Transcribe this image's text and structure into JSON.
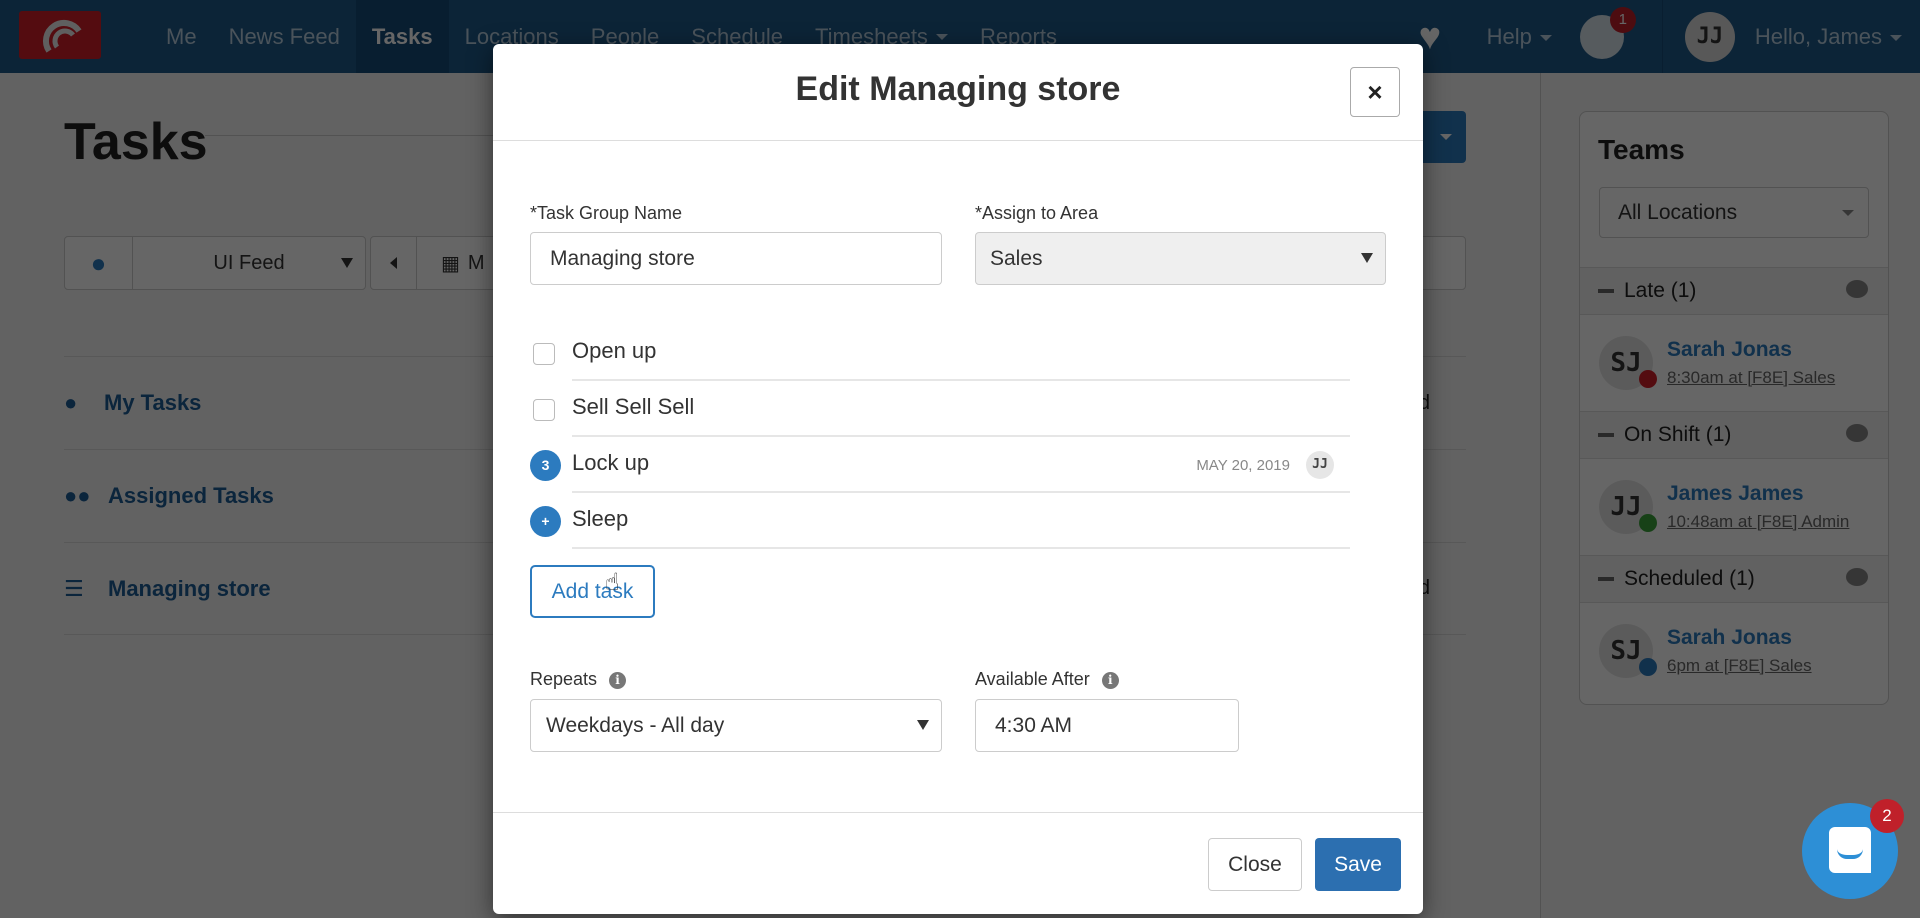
{
  "nav": {
    "items": [
      {
        "label": "Me"
      },
      {
        "label": "News Feed"
      },
      {
        "label": "Tasks",
        "active": true
      },
      {
        "label": "Locations"
      },
      {
        "label": "People"
      },
      {
        "label": "Schedule"
      },
      {
        "label": "Timesheets",
        "dropdown": true
      },
      {
        "label": "Reports"
      }
    ],
    "help_label": "Help",
    "notifications_count": "1",
    "user_initials": "JJ",
    "greeting": "Hello, James",
    "icons": {
      "logo": "app-logo",
      "heart": "heart-icon",
      "globe": "globe-icon"
    }
  },
  "page": {
    "title": "Tasks",
    "toolbar": {
      "feed_select": "UI Feed",
      "date_prefix": "M"
    },
    "task_groups": [
      {
        "label": "My Tasks",
        "icon": "user-icon",
        "tail": "d"
      },
      {
        "label": "Assigned Tasks",
        "icon": "users-icon",
        "tail": ""
      },
      {
        "label": "Managing store",
        "icon": "list-icon",
        "tail": "d"
      }
    ]
  },
  "teams": {
    "title": "Teams",
    "location_select": "All Locations",
    "groups": [
      {
        "label": "Late (1)",
        "people": [
          {
            "initials": "SJ",
            "name": "Sarah Jonas",
            "shift": "8:30am at [F8E] Sales",
            "status_color": "#d3202a"
          }
        ]
      },
      {
        "label": "On Shift (1)",
        "people": [
          {
            "initials": "JJ",
            "name": "James James",
            "shift": "10:48am at [F8E] Admin",
            "status_color": "#3aa33a"
          }
        ]
      },
      {
        "label": "Scheduled (1)",
        "people": [
          {
            "initials": "SJ",
            "name": "Sarah Jonas",
            "shift": "6pm at [F8E] Sales",
            "status_color": "#2c7bbf"
          }
        ]
      }
    ]
  },
  "modal": {
    "title": "Edit Managing store",
    "close_x": "×",
    "task_group_name_label": "*Task Group Name",
    "task_group_name_value": "Managing store",
    "assign_area_label": "*Assign to Area",
    "assign_area_value": "Sales",
    "subtasks": [
      {
        "text": "Open up",
        "type": "checkbox"
      },
      {
        "text": "Sell Sell Sell",
        "type": "checkbox"
      },
      {
        "text": "Lock up",
        "type": "number",
        "badge": "3",
        "date": "MAY 20, 2019",
        "assignee": "JJ"
      },
      {
        "text": "Sleep",
        "type": "number",
        "badge": "+"
      }
    ],
    "add_task_label": "Add task",
    "repeats_label": "Repeats",
    "repeats_value": "Weekdays - All day",
    "available_after_label": "Available After",
    "available_after_value": "4:30 AM",
    "info_glyph": "i",
    "close_label": "Close",
    "save_label": "Save"
  },
  "chat_widget": {
    "unread_count": "2"
  }
}
